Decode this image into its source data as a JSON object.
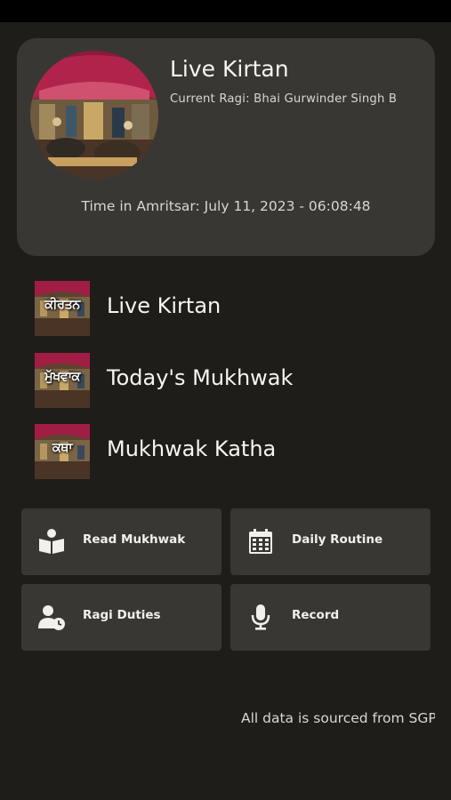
{
  "hero": {
    "title": "Live Kirtan",
    "current_ragi": "Current Ragi: Bhai Gurwinder Singh B",
    "time": "Time in Amritsar: July 11, 2023 - 06:08:48"
  },
  "menu": [
    {
      "thumb_text": "ਕੀਰਤਨ",
      "label": "Live Kirtan"
    },
    {
      "thumb_text": "ਮੁੱਖਵਾਕ",
      "label": "Today's Mukhwak"
    },
    {
      "thumb_text": "ਕਥਾ",
      "label": "Mukhwak Katha"
    }
  ],
  "tiles": [
    {
      "label": "Read Mukhwak",
      "icon": "book-reader-icon"
    },
    {
      "label": "Daily Routine",
      "icon": "calendar-icon"
    },
    {
      "label": "Ragi Duties",
      "icon": "user-clock-icon"
    },
    {
      "label": "Record",
      "icon": "microphone-icon"
    }
  ],
  "footer": {
    "text": "All data is sourced from SGPC"
  },
  "colors": {
    "background": "#1f1d1a",
    "card": "#393734",
    "text": "#f2f0ec"
  }
}
